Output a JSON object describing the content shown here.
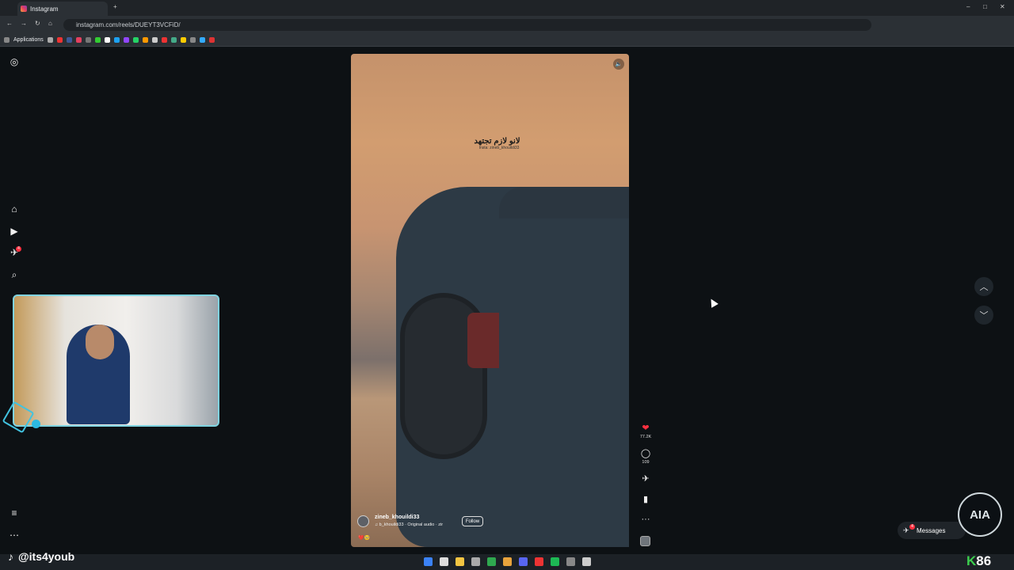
{
  "browser": {
    "tab_title": "Instagram",
    "new_tab": "+",
    "url": "instagram.com/reels/DUEYT3VCFiD/",
    "bookmarks_label": "Applications",
    "win_min": "–",
    "win_max": "□",
    "win_close": "✕"
  },
  "sidebar": {
    "instagram_icon": "◎",
    "home_icon": "⌂",
    "reels_icon": "▶",
    "messages_icon": "✈",
    "messages_badge": "4",
    "search_icon": "⌕",
    "menu_icon": "≡",
    "more_icon": "⋯"
  },
  "reel": {
    "overlay_text": "لانو لازم تجتهد",
    "overlay_credit": "Insta: zineb_khouildi33",
    "mute_icon": "🔈",
    "username": "zineb_khouildi33",
    "audio": "♫ b_khouildi33 · Original audio · zir",
    "follow_label": "Follow",
    "caption": "❤️🥺"
  },
  "actions": {
    "like_icon": "❤",
    "likes": "77.2K",
    "comment_icon": "◯",
    "comments": "109",
    "share_icon": "✈",
    "save_icon": "▮",
    "more_icon": "···"
  },
  "nav": {
    "up_icon": "︿",
    "down_icon": "﹀"
  },
  "messages": {
    "label": "Messages",
    "badge": "4"
  },
  "overlay": {
    "streamer_handle": "@its4youb",
    "streamer_icon": "♪",
    "badge_text": "AIA",
    "counter_k": "K",
    "counter_value": "86"
  },
  "colors": {
    "accent": "#ff3040",
    "cam_border": "#7fd3e0",
    "counter_green": "#3ccf4e"
  }
}
